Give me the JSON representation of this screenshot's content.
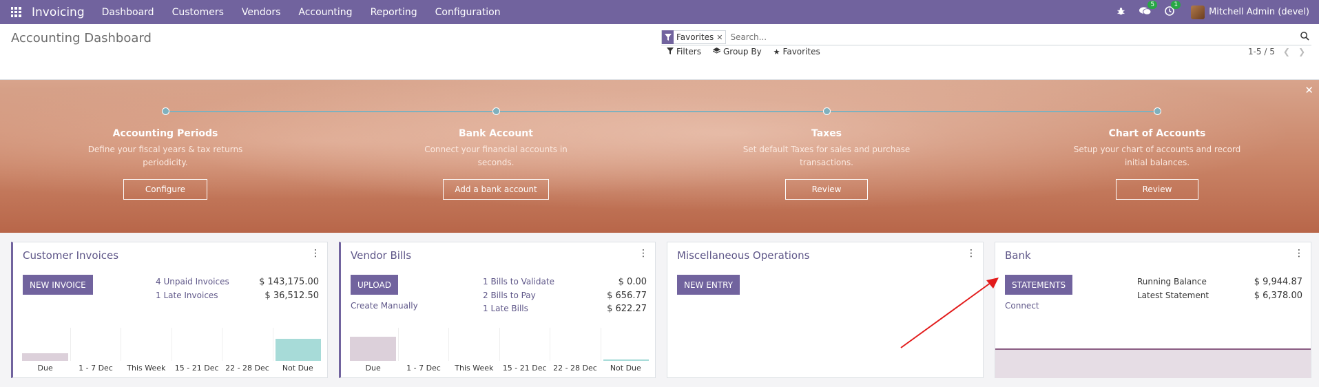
{
  "nav": {
    "brand": "Invoicing",
    "menu": [
      "Dashboard",
      "Customers",
      "Vendors",
      "Accounting",
      "Reporting",
      "Configuration"
    ],
    "messages_badge": "5",
    "activities_badge": "1",
    "user": "Mitchell Admin (devel)"
  },
  "control": {
    "title": "Accounting Dashboard",
    "facet_label": "Favorites",
    "search_placeholder": "Search...",
    "filters": "Filters",
    "group_by": "Group By",
    "favorites": "Favorites",
    "pager": "1-5 / 5"
  },
  "banner": {
    "steps": [
      {
        "title": "Accounting Periods",
        "desc_line1": "Define your fiscal years & tax returns",
        "desc_line2": "periodicity.",
        "button": "Configure"
      },
      {
        "title": "Bank Account",
        "desc_line1": "Connect your financial accounts in",
        "desc_line2": "seconds.",
        "button": "Add a bank account"
      },
      {
        "title": "Taxes",
        "desc_line1": "Set default Taxes for sales and purchase",
        "desc_line2": "transactions.",
        "button": "Review"
      },
      {
        "title": "Chart of Accounts",
        "desc_line1": "Setup your chart of accounts and record",
        "desc_line2": "initial balances.",
        "button": "Review"
      }
    ]
  },
  "cards": {
    "customer": {
      "title": "Customer Invoices",
      "button": "NEW INVOICE",
      "stats": [
        {
          "label": "4 Unpaid Invoices",
          "value": "$ 143,175.00"
        },
        {
          "label": "1 Late Invoices",
          "value": "$ 36,512.50"
        }
      ],
      "chart_labels": [
        "Due",
        "1 - 7 Dec",
        "This Week",
        "15 - 21 Dec",
        "22 - 28 Dec",
        "Not Due"
      ]
    },
    "vendor": {
      "title": "Vendor Bills",
      "button": "UPLOAD",
      "link": "Create Manually",
      "stats": [
        {
          "label": "1 Bills to Validate",
          "value": "$ 0.00"
        },
        {
          "label": "2 Bills to Pay",
          "value": "$ 656.77"
        },
        {
          "label": "1 Late Bills",
          "value": "$ 622.27"
        }
      ],
      "chart_labels": [
        "Due",
        "1 - 7 Dec",
        "This Week",
        "15 - 21 Dec",
        "22 - 28 Dec",
        "Not Due"
      ]
    },
    "misc": {
      "title": "Miscellaneous Operations",
      "button": "NEW ENTRY"
    },
    "bank": {
      "title": "Bank",
      "button": "STATEMENTS",
      "link": "Connect",
      "stats": [
        {
          "label": "Running Balance",
          "value": "$ 9,944.87"
        },
        {
          "label": "Latest Statement",
          "value": "$ 6,378.00"
        }
      ]
    }
  },
  "colors": {
    "brand": "#71639e",
    "due_bar": "#dcd0da",
    "not_due_bar": "#a7dbd8"
  }
}
